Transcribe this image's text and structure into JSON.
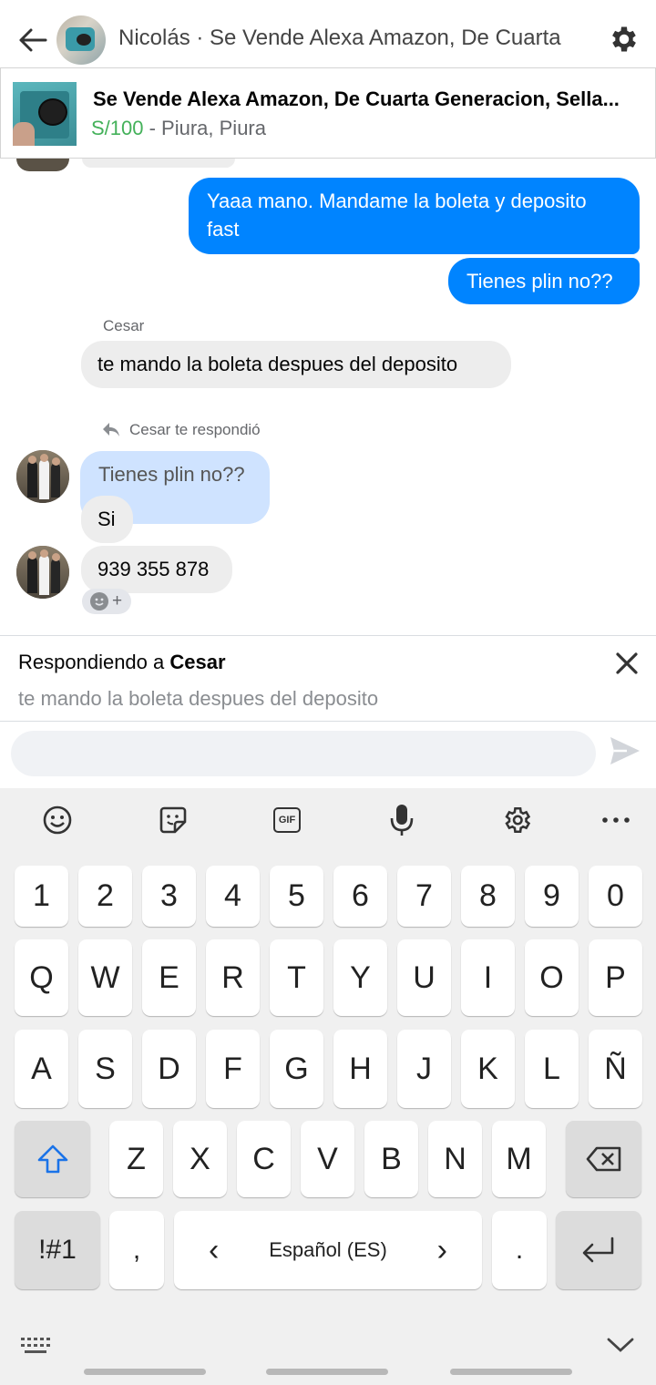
{
  "header": {
    "title": "Nicolás · Se Vende Alexa Amazon, De Cuarta",
    "back_icon": "back-arrow-icon",
    "settings_icon": "gear-icon"
  },
  "product": {
    "title": "Se Vende Alexa Amazon, De Cuarta Generacion, Sella...",
    "price": "S/100",
    "location": " - Piura, Piura",
    "price_color": "#44b15a"
  },
  "messages": {
    "out_1": "Yaaa mano. Mandame la boleta y deposito fast",
    "out_2": "Tienes plin no??",
    "in_sender": "Cesar",
    "in_1": "te mando la boleta despues del deposito",
    "reply_note": "Cesar te respondió",
    "quoted": "Tienes plin no??",
    "in_2": "Si",
    "in_3": "939 355 878"
  },
  "reply_bar": {
    "prefix": "Respondiendo a ",
    "name": "Cesar",
    "quote": "te mando la boleta despues del deposito"
  },
  "composer": {
    "placeholder": "",
    "send_icon": "send-icon"
  },
  "keyboard": {
    "toolbar": [
      "emoji-icon",
      "sticker-icon",
      "gif-icon",
      "microphone-icon",
      "gear-icon",
      "more-icon"
    ],
    "gif_label": "GIF",
    "row_numbers": [
      "1",
      "2",
      "3",
      "4",
      "5",
      "6",
      "7",
      "8",
      "9",
      "0"
    ],
    "row_1": [
      "Q",
      "W",
      "E",
      "R",
      "T",
      "Y",
      "U",
      "I",
      "O",
      "P"
    ],
    "row_2": [
      "A",
      "S",
      "D",
      "F",
      "G",
      "H",
      "J",
      "K",
      "L",
      "Ñ"
    ],
    "row_3": [
      "Z",
      "X",
      "C",
      "V",
      "B",
      "N",
      "M"
    ],
    "symbols_label": "!#1",
    "comma_label": ",",
    "space_label": "Español (ES)",
    "space_left": "‹",
    "space_right": "›",
    "period_label": ".",
    "accent_color": "#0084ff",
    "incoming_quote_color": "#cfe3ff"
  }
}
